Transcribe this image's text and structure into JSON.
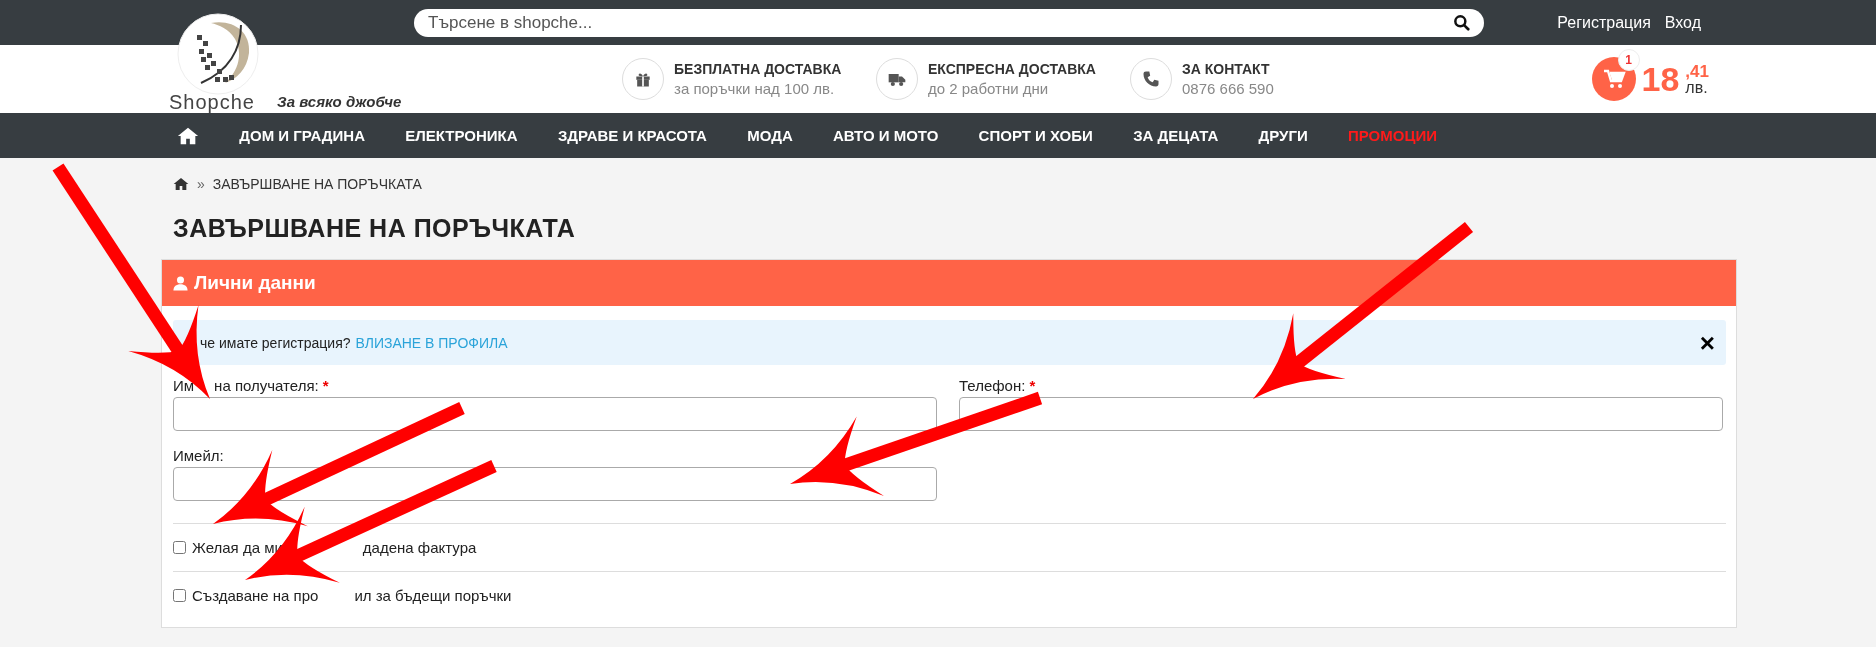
{
  "top_bar": {
    "search": {
      "placeholder": "Търсене в shopche..."
    },
    "links": [
      "Регистрация",
      "Вход"
    ]
  },
  "logo": {
    "name": "Shopche",
    "tagline": "За всяко джобче"
  },
  "features": [
    {
      "kind": "gift",
      "title": "БЕЗПЛАТНА ДОСТАВКА",
      "text": "за поръчки над 100 лв."
    },
    {
      "kind": "truck",
      "title": "ЕКСПРЕСНА ДОСТАВКА",
      "text": "до 2 работни дни"
    },
    {
      "kind": "phone",
      "title": "ЗА КОНТАКТ",
      "text": "0876 666 590"
    }
  ],
  "cart": {
    "count": "1",
    "whole": "18",
    "fraction": ",41",
    "currency": "лв."
  },
  "nav": [
    {
      "label": "ДОМ И ГРАДИНА",
      "promo": false
    },
    {
      "label": "ЕЛЕКТРОНИКА",
      "promo": false
    },
    {
      "label": "ЗДРАВЕ И КРАСОТА",
      "promo": false
    },
    {
      "label": "МОДА",
      "promo": false
    },
    {
      "label": "АВТО И МОТО",
      "promo": false
    },
    {
      "label": "СПОРТ И ХОБИ",
      "promo": false
    },
    {
      "label": "ЗА ДЕЦАТА",
      "promo": false
    },
    {
      "label": "ДРУГИ",
      "promo": false
    },
    {
      "label": "ПРОМОЦИИ",
      "promo": true
    }
  ],
  "breadcrumb": {
    "separator": "»",
    "current": "ЗАВЪРШВАНЕ НА ПОРЪЧКАТА"
  },
  "page_title": "ЗАВЪРШВАНЕ НА ПОРЪЧКАТА",
  "panel": {
    "title": "Лични данни",
    "alert": {
      "text_parts": [
        "че имате регистрация?"
      ],
      "link": "ВЛИЗАНЕ В ПРОФИЛА",
      "close": "×"
    },
    "fields": [
      {
        "label_parts": [
          "Им",
          "на получателя:"
        ],
        "required_mark": "*"
      },
      {
        "label_parts": [
          "Телефон:"
        ],
        "required_mark": "*"
      },
      {
        "label_parts": [
          "Имейл:"
        ]
      }
    ],
    "checkboxes": [
      {
        "label_parts": [
          "Желая да ми",
          "дадена фактура"
        ],
        "checked": false
      },
      {
        "label_parts": [
          "Създаване на про",
          "ил за бъдещи поръчки"
        ],
        "checked": false
      }
    ]
  }
}
